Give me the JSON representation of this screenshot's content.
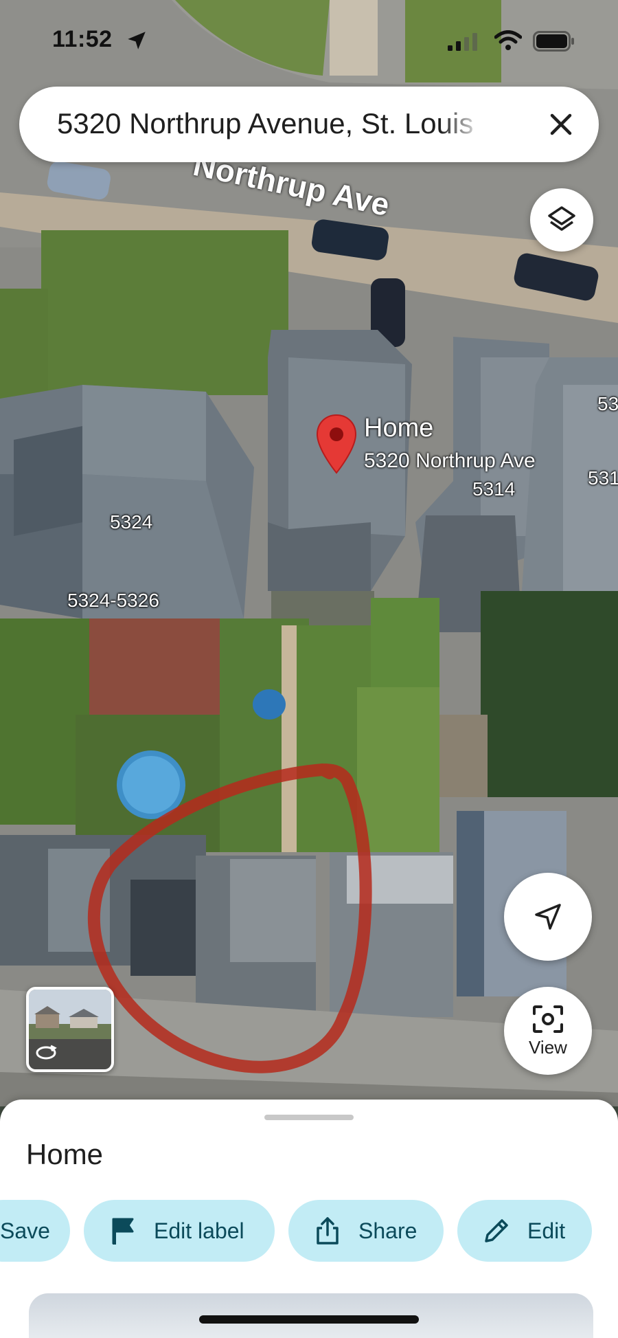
{
  "status": {
    "time": "11:52"
  },
  "search": {
    "query": "5320 Northrup Avenue, St. Louis"
  },
  "map": {
    "street_name": "Northrup Ave",
    "home_label": "Home",
    "home_address": "5320 Northrup Ave",
    "parcels": [
      "5314",
      "5324",
      "5324-5326",
      "53",
      "531"
    ]
  },
  "buttons": {
    "view_label": "View"
  },
  "sheet": {
    "title": "Home",
    "actions": [
      {
        "label": "Save",
        "icon": "bookmark-icon"
      },
      {
        "label": "Edit label",
        "icon": "flag-icon"
      },
      {
        "label": "Share",
        "icon": "share-icon"
      },
      {
        "label": "Edit",
        "icon": "pencil-icon"
      }
    ]
  },
  "colors": {
    "accent_chip": "#c2ecf5",
    "chip_text": "#0b4a5a",
    "pin": "#e53935",
    "annotation": "#b52a1c"
  }
}
